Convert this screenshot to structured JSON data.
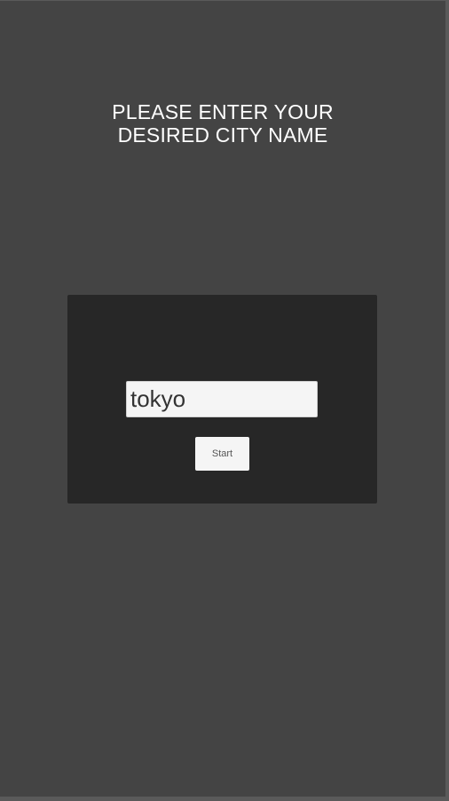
{
  "header": {
    "title_line1": "PLEASE ENTER YOUR",
    "title_line2": "DESIRED CITY NAME"
  },
  "form": {
    "city_value": "tokyo",
    "start_label": "Start"
  },
  "colors": {
    "background": "#444444",
    "panel": "#272727",
    "input_bg": "#f5f5f5",
    "title_text": "#ffffff"
  }
}
